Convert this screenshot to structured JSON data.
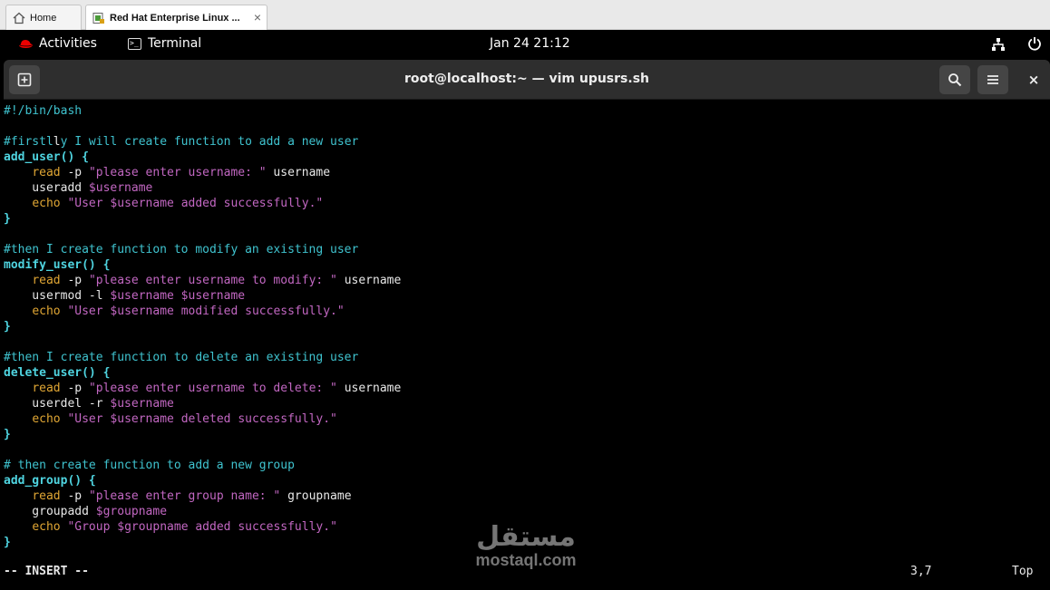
{
  "vm_tabs": {
    "home_label": "Home",
    "rhel_label": "Red Hat Enterprise Linux ...",
    "close_glyph": "×"
  },
  "topbar": {
    "activities_label": "Activities",
    "app_label": "Terminal",
    "clock": "Jan 24  21:12"
  },
  "terminal": {
    "title": "root@localhost:~ — vim upusrs.sh",
    "close_glyph": "×"
  },
  "editor": {
    "lines": [
      [
        {
          "t": "#!/bin/bash",
          "c": "comment"
        }
      ],
      [],
      [
        {
          "t": "#firstl",
          "c": "comment"
        },
        {
          "t": "l",
          "c": "cursor"
        },
        {
          "t": "y I will create function to add a new user",
          "c": "comment"
        }
      ],
      [
        {
          "t": "add_user() {",
          "c": "func"
        }
      ],
      [
        {
          "t": "    ",
          "c": "plain"
        },
        {
          "t": "read",
          "c": "kw"
        },
        {
          "t": " -p ",
          "c": "plain"
        },
        {
          "t": "\"please enter username: \"",
          "c": "str"
        },
        {
          "t": " username",
          "c": "plain"
        }
      ],
      [
        {
          "t": "    useradd ",
          "c": "plain"
        },
        {
          "t": "$username",
          "c": "var"
        }
      ],
      [
        {
          "t": "    ",
          "c": "plain"
        },
        {
          "t": "echo",
          "c": "kw"
        },
        {
          "t": " ",
          "c": "plain"
        },
        {
          "t": "\"User ",
          "c": "str"
        },
        {
          "t": "$username",
          "c": "var"
        },
        {
          "t": " added successfully.\"",
          "c": "str"
        }
      ],
      [
        {
          "t": "}",
          "c": "brace"
        }
      ],
      [],
      [
        {
          "t": "#then I create function to modify an existing user",
          "c": "comment"
        }
      ],
      [
        {
          "t": "modify_user() {",
          "c": "func"
        }
      ],
      [
        {
          "t": "    ",
          "c": "plain"
        },
        {
          "t": "read",
          "c": "kw"
        },
        {
          "t": " -p ",
          "c": "plain"
        },
        {
          "t": "\"please enter username to modify: \"",
          "c": "str"
        },
        {
          "t": " username",
          "c": "plain"
        }
      ],
      [
        {
          "t": "    usermod -l ",
          "c": "plain"
        },
        {
          "t": "$username $username",
          "c": "var"
        }
      ],
      [
        {
          "t": "    ",
          "c": "plain"
        },
        {
          "t": "echo",
          "c": "kw"
        },
        {
          "t": " ",
          "c": "plain"
        },
        {
          "t": "\"User ",
          "c": "str"
        },
        {
          "t": "$username",
          "c": "var"
        },
        {
          "t": " modified successfully.\"",
          "c": "str"
        }
      ],
      [
        {
          "t": "}",
          "c": "brace"
        }
      ],
      [],
      [
        {
          "t": "#then I create function to delete an existing user",
          "c": "comment"
        }
      ],
      [
        {
          "t": "delete_user() {",
          "c": "func"
        }
      ],
      [
        {
          "t": "    ",
          "c": "plain"
        },
        {
          "t": "read",
          "c": "kw"
        },
        {
          "t": " -p ",
          "c": "plain"
        },
        {
          "t": "\"please enter username to delete: \"",
          "c": "str"
        },
        {
          "t": " username",
          "c": "plain"
        }
      ],
      [
        {
          "t": "    userdel -r ",
          "c": "plain"
        },
        {
          "t": "$username",
          "c": "var"
        }
      ],
      [
        {
          "t": "    ",
          "c": "plain"
        },
        {
          "t": "echo",
          "c": "kw"
        },
        {
          "t": " ",
          "c": "plain"
        },
        {
          "t": "\"User ",
          "c": "str"
        },
        {
          "t": "$username",
          "c": "var"
        },
        {
          "t": " deleted successfully.\"",
          "c": "str"
        }
      ],
      [
        {
          "t": "}",
          "c": "brace"
        }
      ],
      [],
      [
        {
          "t": "# then create function to add a new group",
          "c": "comment"
        }
      ],
      [
        {
          "t": "add_group() {",
          "c": "func"
        }
      ],
      [
        {
          "t": "    ",
          "c": "plain"
        },
        {
          "t": "read",
          "c": "kw"
        },
        {
          "t": " -p ",
          "c": "plain"
        },
        {
          "t": "\"please enter group name: \"",
          "c": "str"
        },
        {
          "t": " groupname",
          "c": "plain"
        }
      ],
      [
        {
          "t": "    groupadd ",
          "c": "plain"
        },
        {
          "t": "$groupname",
          "c": "var"
        }
      ],
      [
        {
          "t": "    ",
          "c": "plain"
        },
        {
          "t": "echo",
          "c": "kw"
        },
        {
          "t": " ",
          "c": "plain"
        },
        {
          "t": "\"Group ",
          "c": "str"
        },
        {
          "t": "$groupname",
          "c": "var"
        },
        {
          "t": " added successfully.\"",
          "c": "str"
        }
      ],
      [
        {
          "t": "}",
          "c": "brace"
        }
      ]
    ]
  },
  "statusline": {
    "mode": "-- INSERT --",
    "position": "3,7",
    "scroll": "Top"
  },
  "watermark": {
    "logo": "مستقل",
    "site": "mostaql.com"
  },
  "colors": {
    "comment": "#3fc3cf",
    "keyword": "#e0a634",
    "string": "#c267c2",
    "redhat": "#ee0000"
  }
}
